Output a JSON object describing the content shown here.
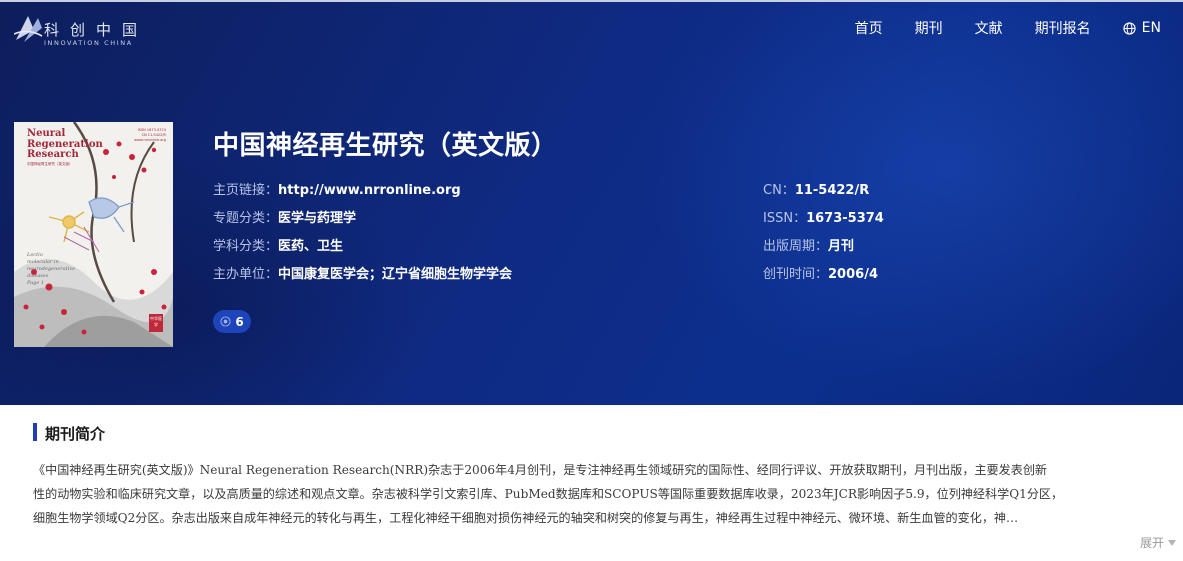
{
  "header": {
    "logo_cn": "科创中国",
    "logo_en": "INNOVATION CHINA",
    "nav": [
      {
        "label": "首页"
      },
      {
        "label": "期刊"
      },
      {
        "label": "文献"
      },
      {
        "label": "期刊报名"
      },
      {
        "label": "EN",
        "icon": "globe-icon"
      }
    ]
  },
  "cover": {
    "title": "Neural Regeneration Research",
    "subtitle": "中国神经再生研究（英文版）",
    "right_text": "ISSN 1673-5374\nCN 11-5422/R\nwww.nrronline.org",
    "italic_text": "Lectio\nmolecular in\nneurodegenerative\ndiseases\nPage 1",
    "seal": "中华医学"
  },
  "journal": {
    "title": "中国神经再生研究（英文版）",
    "homepage_label": "主页链接：",
    "homepage_value": "http://www.nrronline.org",
    "topic_label": "专题分类：",
    "topic_value": "医学与药理学",
    "discipline_label": "学科分类：",
    "discipline_value": "医药、卫生",
    "sponsor_label": "主办单位：",
    "sponsor_value": "中国康复医学会；辽宁省细胞生物学学会",
    "cn_label": "CN：",
    "cn_value": "11-5422/R",
    "issn_label": "ISSN：",
    "issn_value": "1673-5374",
    "cycle_label": "出版周期：",
    "cycle_value": "月刊",
    "founded_label": "创刊时间：",
    "founded_value": "2006/4",
    "views": "6"
  },
  "intro": {
    "heading": "期刊简介",
    "lines": [
      "《中国神经再生研究(英文版)》Neural Regeneration Research(NRR)杂志于2006年4月创刊，是专注神经再生领域研究的国际性、经同行评议、开放获取期刊，月刊出版，主要发表创新",
      "性的动物实验和临床研究文章，以及高质量的综述和观点文章。杂志被科学引文索引库、PubMed数据库和SCOPUS等国际重要数据库收录，2023年JCR影响因子5.9，位列神经科学Q1分区，",
      "细胞生物学领域Q2分区。杂志出版来自成年神经元的转化与再生，工程化神经干细胞对损伤神经元的轴突和树突的修复与再生，神经再生过程中神经元、微环境、新生血管的变化，神…"
    ],
    "expand_label": "展开"
  }
}
